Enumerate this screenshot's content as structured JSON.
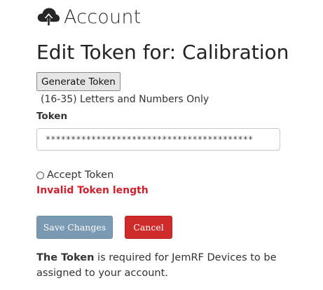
{
  "logo": {
    "icon": "cloud-upload-icon",
    "text": "Account"
  },
  "page": {
    "title": "Edit Token for: Calibration"
  },
  "token": {
    "generate_label": "Generate Token",
    "hint": "(16-35) Letters and Numbers Only",
    "field_label": "Token",
    "masked_value": "*****************************************",
    "accept_label": "Accept Token",
    "accept_checked": false,
    "error": "Invalid Token length"
  },
  "actions": {
    "save_label": "Save Changes",
    "cancel_label": "Cancel"
  },
  "footer": {
    "bold_lead": "The Token",
    "text": " is required for JemRF Devices to be assigned to your account."
  },
  "colors": {
    "save_bg": "#7a9ab4",
    "cancel_bg": "#cf2b2b",
    "error": "#d4202c"
  }
}
